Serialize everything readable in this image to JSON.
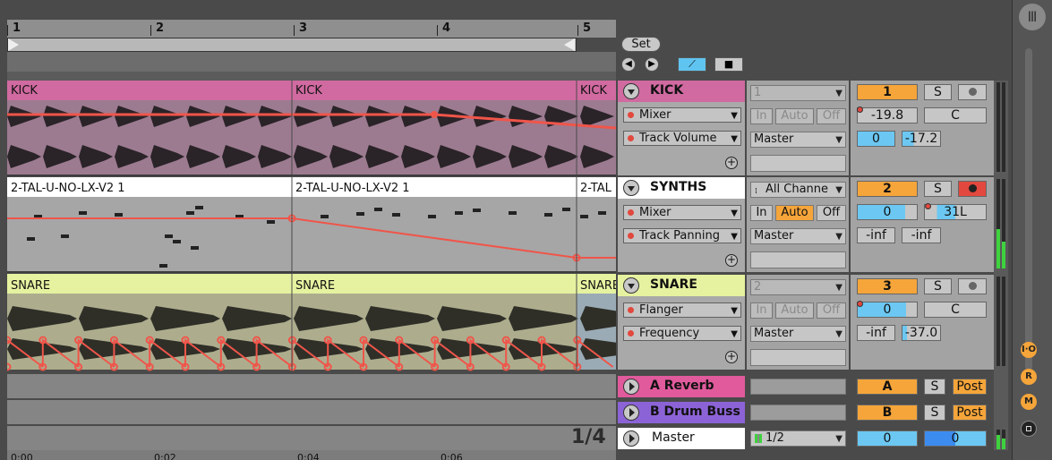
{
  "ruler": {
    "bars": [
      "1",
      "2",
      "3",
      "4",
      "5"
    ],
    "time_labels": [
      "0:00",
      "0:02",
      "0:04",
      "0:06"
    ]
  },
  "zoom": "1/4",
  "set_button": "Set",
  "clips": {
    "kick": [
      "KICK",
      "KICK",
      "KICK"
    ],
    "synth": [
      "2-TAL-U-NO-LX-V2 1",
      "2-TAL-U-NO-LX-V2 1",
      "2-TAL"
    ],
    "snare": [
      "SNARE",
      "SNARE",
      "SNARE"
    ]
  },
  "tracks": [
    {
      "name": "KICK",
      "color": "#d06aa0",
      "device": "Mixer",
      "param": "Track Volume",
      "input": "1",
      "monitor": [
        "In",
        "Auto",
        "Off"
      ],
      "output": "Master",
      "number": "1",
      "solo": "S",
      "volume": "-19.8",
      "pan": "C",
      "send_a": "0",
      "send_b": "-17.2"
    },
    {
      "name": "SYNTHS",
      "color": "#ffffff",
      "device": "Mixer",
      "param": "Track Panning",
      "input": "All Channe",
      "monitor": [
        "In",
        "Auto",
        "Off"
      ],
      "output": "Master",
      "number": "2",
      "solo": "S",
      "volume": "0",
      "pan": "31L",
      "send_a": "-inf",
      "send_b": "-inf"
    },
    {
      "name": "SNARE",
      "color": "#e6f2a0",
      "device": "Flanger",
      "param": "Frequency",
      "input": "2",
      "monitor": [
        "In",
        "Auto",
        "Off"
      ],
      "output": "Master",
      "number": "3",
      "solo": "S",
      "volume": "0",
      "pan": "C",
      "send_a": "-inf",
      "send_b": "-37.0"
    }
  ],
  "returns": [
    {
      "name": "A Reverb",
      "color": "#e05a9c",
      "letter": "A",
      "solo": "S",
      "post": "Post"
    },
    {
      "name": "B Drum Buss",
      "color": "#8c63d6",
      "letter": "B",
      "solo": "S",
      "post": "Post"
    }
  ],
  "master": {
    "name": "Master",
    "cue": "1/2",
    "volume": "0",
    "pan": "0"
  },
  "side_buttons": [
    "I·O",
    "R",
    "M"
  ]
}
